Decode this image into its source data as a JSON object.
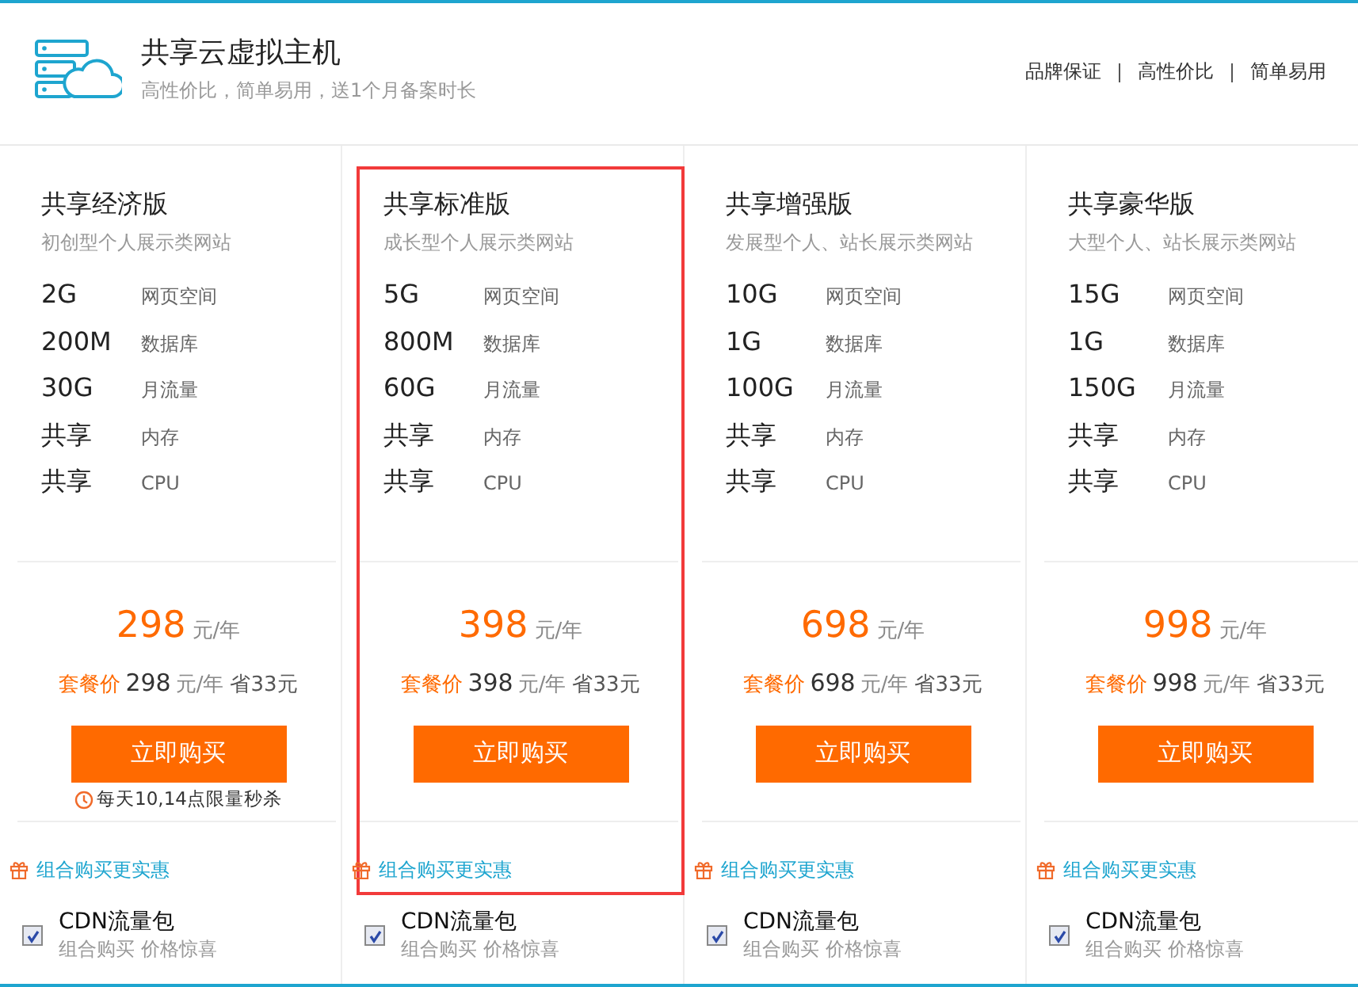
{
  "header": {
    "title": "共享云虚拟主机",
    "subtitle": "高性价比，简单易用，送1个月备案时长",
    "features": [
      "品牌保证",
      "高性价比",
      "简单易用"
    ]
  },
  "plans": [
    {
      "name": "共享经济版",
      "desc": "初创型个人展示类网站",
      "selected": false,
      "specs": [
        {
          "value": "2G",
          "label": "网页空间"
        },
        {
          "value": "200M",
          "label": "数据库"
        },
        {
          "value": "30G",
          "label": "月流量"
        },
        {
          "value": "共享",
          "label": "内存"
        },
        {
          "value": "共享",
          "label": "CPU"
        }
      ],
      "price": "298",
      "unit": "元/年",
      "package_label": "套餐价",
      "package_price": "298",
      "package_unit": "元/年",
      "saving": "省33元",
      "buy": "立即购买",
      "flash_note": "每天10,14点限量秒杀",
      "combo": "组合购买更实惠",
      "addon": {
        "checked": true,
        "title": "CDN流量包",
        "subtitle": "组合购买 价格惊喜"
      }
    },
    {
      "name": "共享标准版",
      "desc": "成长型个人展示类网站",
      "selected": true,
      "specs": [
        {
          "value": "5G",
          "label": "网页空间"
        },
        {
          "value": "800M",
          "label": "数据库"
        },
        {
          "value": "60G",
          "label": "月流量"
        },
        {
          "value": "共享",
          "label": "内存"
        },
        {
          "value": "共享",
          "label": "CPU"
        }
      ],
      "price": "398",
      "unit": "元/年",
      "package_label": "套餐价",
      "package_price": "398",
      "package_unit": "元/年",
      "saving": "省33元",
      "buy": "立即购买",
      "combo": "组合购买更实惠",
      "addon": {
        "checked": true,
        "title": "CDN流量包",
        "subtitle": "组合购买 价格惊喜"
      }
    },
    {
      "name": "共享增强版",
      "desc": "发展型个人、站长展示类网站",
      "selected": false,
      "specs": [
        {
          "value": "10G",
          "label": "网页空间"
        },
        {
          "value": "1G",
          "label": "数据库"
        },
        {
          "value": "100G",
          "label": "月流量"
        },
        {
          "value": "共享",
          "label": "内存"
        },
        {
          "value": "共享",
          "label": "CPU"
        }
      ],
      "price": "698",
      "unit": "元/年",
      "package_label": "套餐价",
      "package_price": "698",
      "package_unit": "元/年",
      "saving": "省33元",
      "buy": "立即购买",
      "combo": "组合购买更实惠",
      "addon": {
        "checked": true,
        "title": "CDN流量包",
        "subtitle": "组合购买 价格惊喜"
      }
    },
    {
      "name": "共享豪华版",
      "desc": "大型个人、站长展示类网站",
      "selected": false,
      "specs": [
        {
          "value": "15G",
          "label": "网页空间"
        },
        {
          "value": "1G",
          "label": "数据库"
        },
        {
          "value": "150G",
          "label": "月流量"
        },
        {
          "value": "共享",
          "label": "内存"
        },
        {
          "value": "共享",
          "label": "CPU"
        }
      ],
      "price": "998",
      "unit": "元/年",
      "package_label": "套餐价",
      "package_price": "998",
      "package_unit": "元/年",
      "saving": "省33元",
      "buy": "立即购买",
      "combo": "组合购买更实惠",
      "addon": {
        "checked": true,
        "title": "CDN流量包",
        "subtitle": "组合购买 价格惊喜"
      }
    }
  ]
}
